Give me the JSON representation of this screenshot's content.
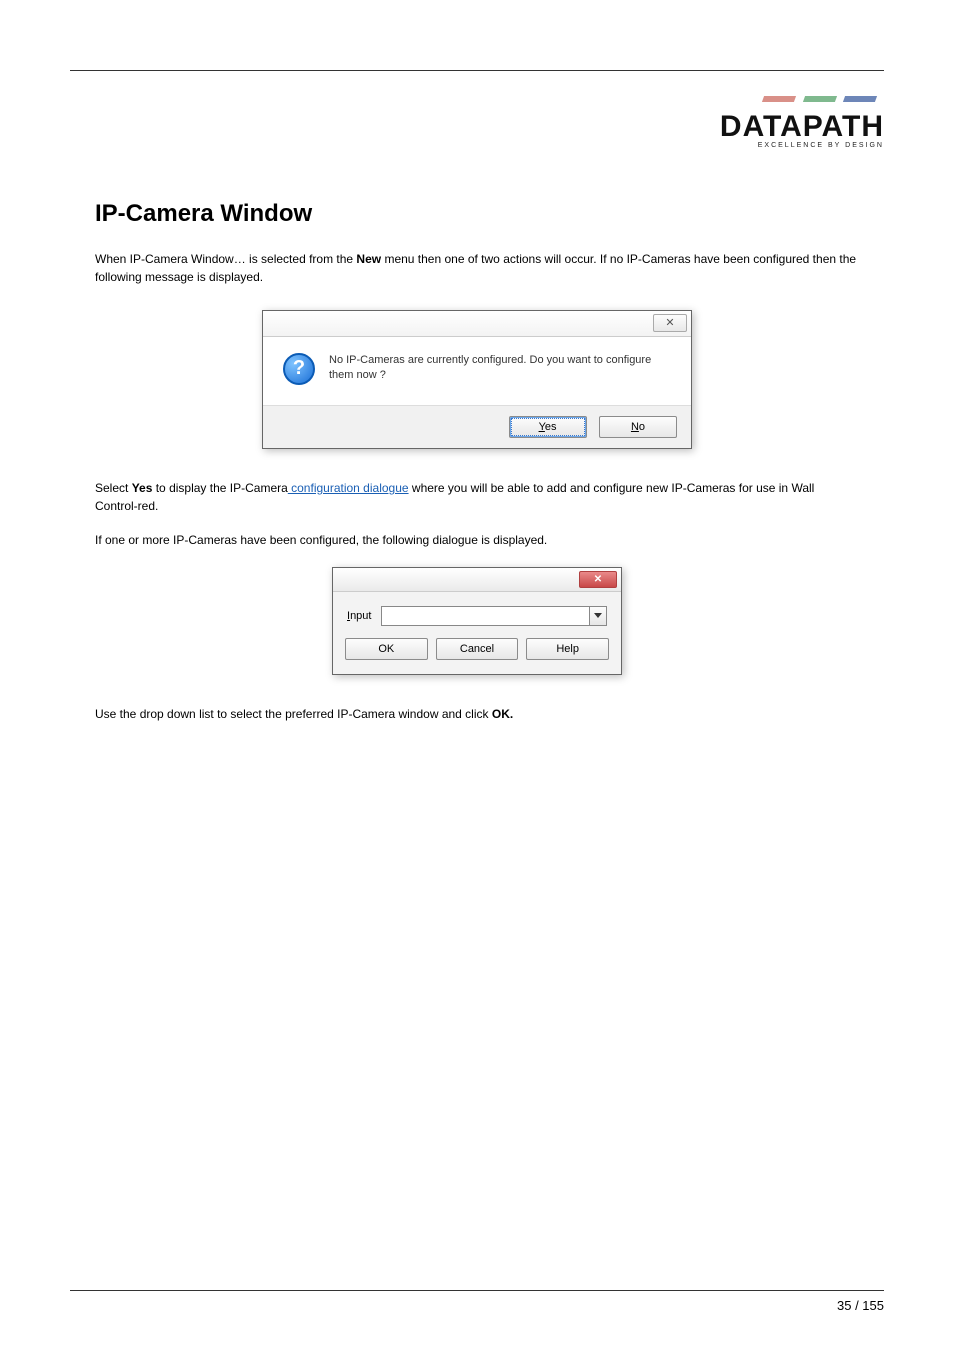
{
  "logo": {
    "brand": "DATAPATH",
    "tagline": "EXCELLENCE BY DESIGN"
  },
  "heading": "IP-Camera Window",
  "para1_pre": "When IP-Camera Window… is selected from the ",
  "para1_bold": "New",
  "para1_post": " menu then one of two actions will occur. If no IP-Cameras have been configured then the following message is displayed.",
  "dialog1": {
    "close_glyph": "✕",
    "message": "No IP-Cameras are currently configured. Do you want to configure them now ?",
    "yes_m": "Y",
    "yes_rest": "es",
    "no_m": "N",
    "no_rest": "o"
  },
  "para2_pre": "Select ",
  "para2_bold": "Yes",
  "para2_mid": " to display the IP-Camera",
  "para2_link": " configuration dialogue",
  "para2_post": " where you will be able to add and configure new IP-Cameras for use in Wall Control-red.",
  "para3": "If one or more IP-Cameras have been configured, the following dialogue is displayed.",
  "dialog2": {
    "close_glyph": "✕",
    "label_m": "I",
    "label_rest": "nput",
    "ok": "OK",
    "cancel": "Cancel",
    "help": "Help"
  },
  "para4_pre": "Use the drop down list to select the preferred IP-Camera window and click ",
  "para4_bold": "OK.",
  "pager": "35 / 155"
}
